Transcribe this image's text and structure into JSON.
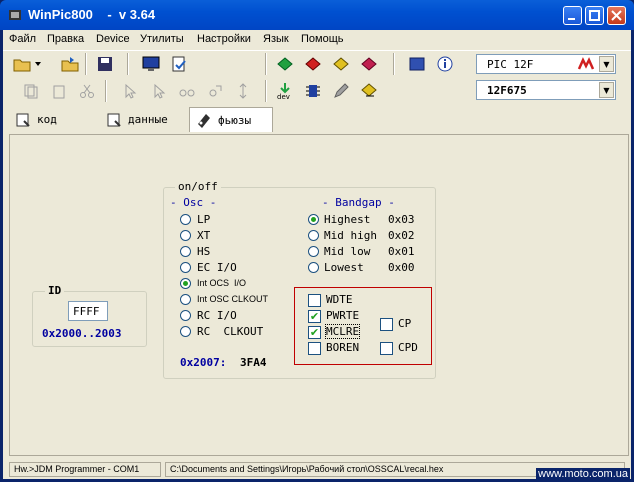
{
  "window": {
    "title": "WinPic800    -  v 3.64"
  },
  "menu": {
    "items": [
      "Файл",
      "Правка",
      "Device",
      "Утилиты",
      "Настройки",
      "Язык",
      "Помощь"
    ]
  },
  "toolbar": {
    "device_family": "PIC 12F",
    "device_model": "12F675"
  },
  "tabs": [
    {
      "label": "код"
    },
    {
      "label": "данные"
    },
    {
      "label": "фьюзы"
    }
  ],
  "id_group": {
    "title": "ID",
    "value": "FFFF",
    "range": "0x2000..2003"
  },
  "config": {
    "title": "on/off",
    "osc_header": "- Osc -",
    "osc_options": [
      "LP",
      "XT",
      "HS",
      "EC I/O",
      "Int OCS  I/O",
      "Int OSC CLKOUT",
      "RC I/O",
      "RC  CLKOUT"
    ],
    "osc_selected": 4,
    "bandgap_header": "- Bandgap -",
    "bandgap_options": [
      {
        "label": "Highest",
        "value": "0x03"
      },
      {
        "label": "Mid high",
        "value": "0x02"
      },
      {
        "label": "Mid low",
        "value": "0x01"
      },
      {
        "label": "Lowest",
        "value": "0x00"
      }
    ],
    "bandgap_selected": 0,
    "address": "0x2007:",
    "word": "3FA4",
    "fuses": [
      {
        "label": "WDTE",
        "checked": false
      },
      {
        "label": "PWRTE",
        "checked": true
      },
      {
        "label": "MCLRE",
        "checked": true
      },
      {
        "label": "BOREN",
        "checked": false
      },
      {
        "label": "CP",
        "checked": false
      },
      {
        "label": "CPD",
        "checked": false
      }
    ]
  },
  "status": {
    "programmer": "Hw.>JDM Programmer - COM1",
    "file": "C:\\Documents and Settings\\Игорь\\Рабочий стол\\OSSCAL\\recal.hex"
  },
  "watermark": "www.moto.com.ua",
  "colors": {
    "titlebar": "#0050d0",
    "face": "#ece9d8",
    "label_blue": "#0000a0",
    "fuse_box": "#c00000"
  }
}
